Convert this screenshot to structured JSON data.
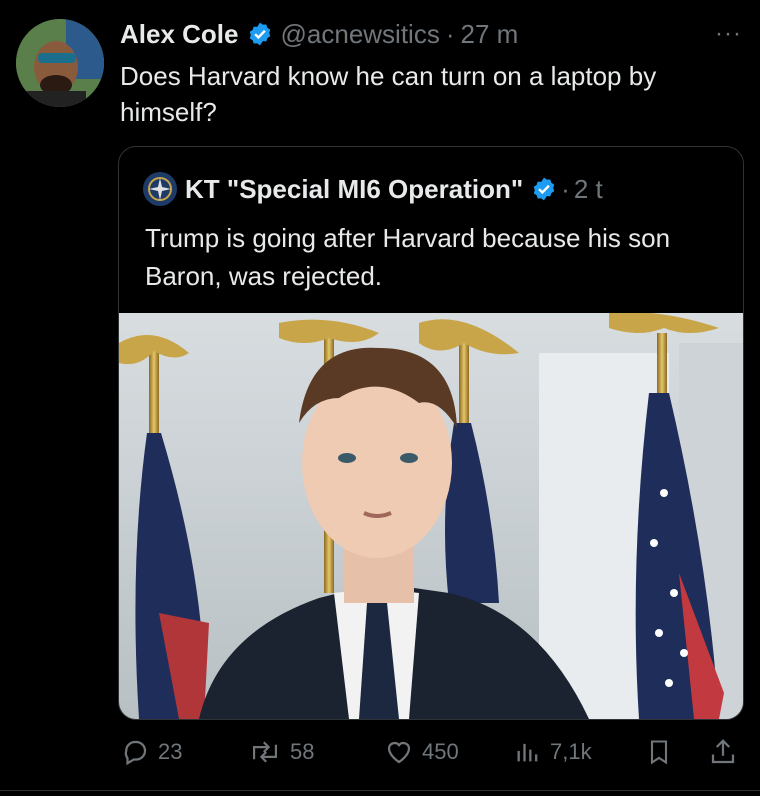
{
  "tweet": {
    "author_name": "Alex Cole",
    "handle": "@acnewsitics",
    "separator": "·",
    "time": "27 m",
    "more_label": "···",
    "text": "Does Harvard know he can turn on a laptop by himself?"
  },
  "quote": {
    "author_name": "KT \"Special MI6 Operation\"",
    "separator": "·",
    "time": "2 t",
    "text": "Trump is going after Harvard because his son Baron, was rejected."
  },
  "actions": {
    "replies": "23",
    "reposts": "58",
    "likes": "450",
    "views": "7,1k"
  },
  "colors": {
    "background": "#000000",
    "text": "#e7e9ea",
    "muted": "#71767b",
    "verified": "#1d9bf0",
    "border": "#2f3336"
  },
  "icons": [
    "avatar",
    "verified-badge-icon",
    "more-icon",
    "reply-icon",
    "repost-icon",
    "like-icon",
    "views-icon",
    "bookmark-icon",
    "share-icon"
  ]
}
